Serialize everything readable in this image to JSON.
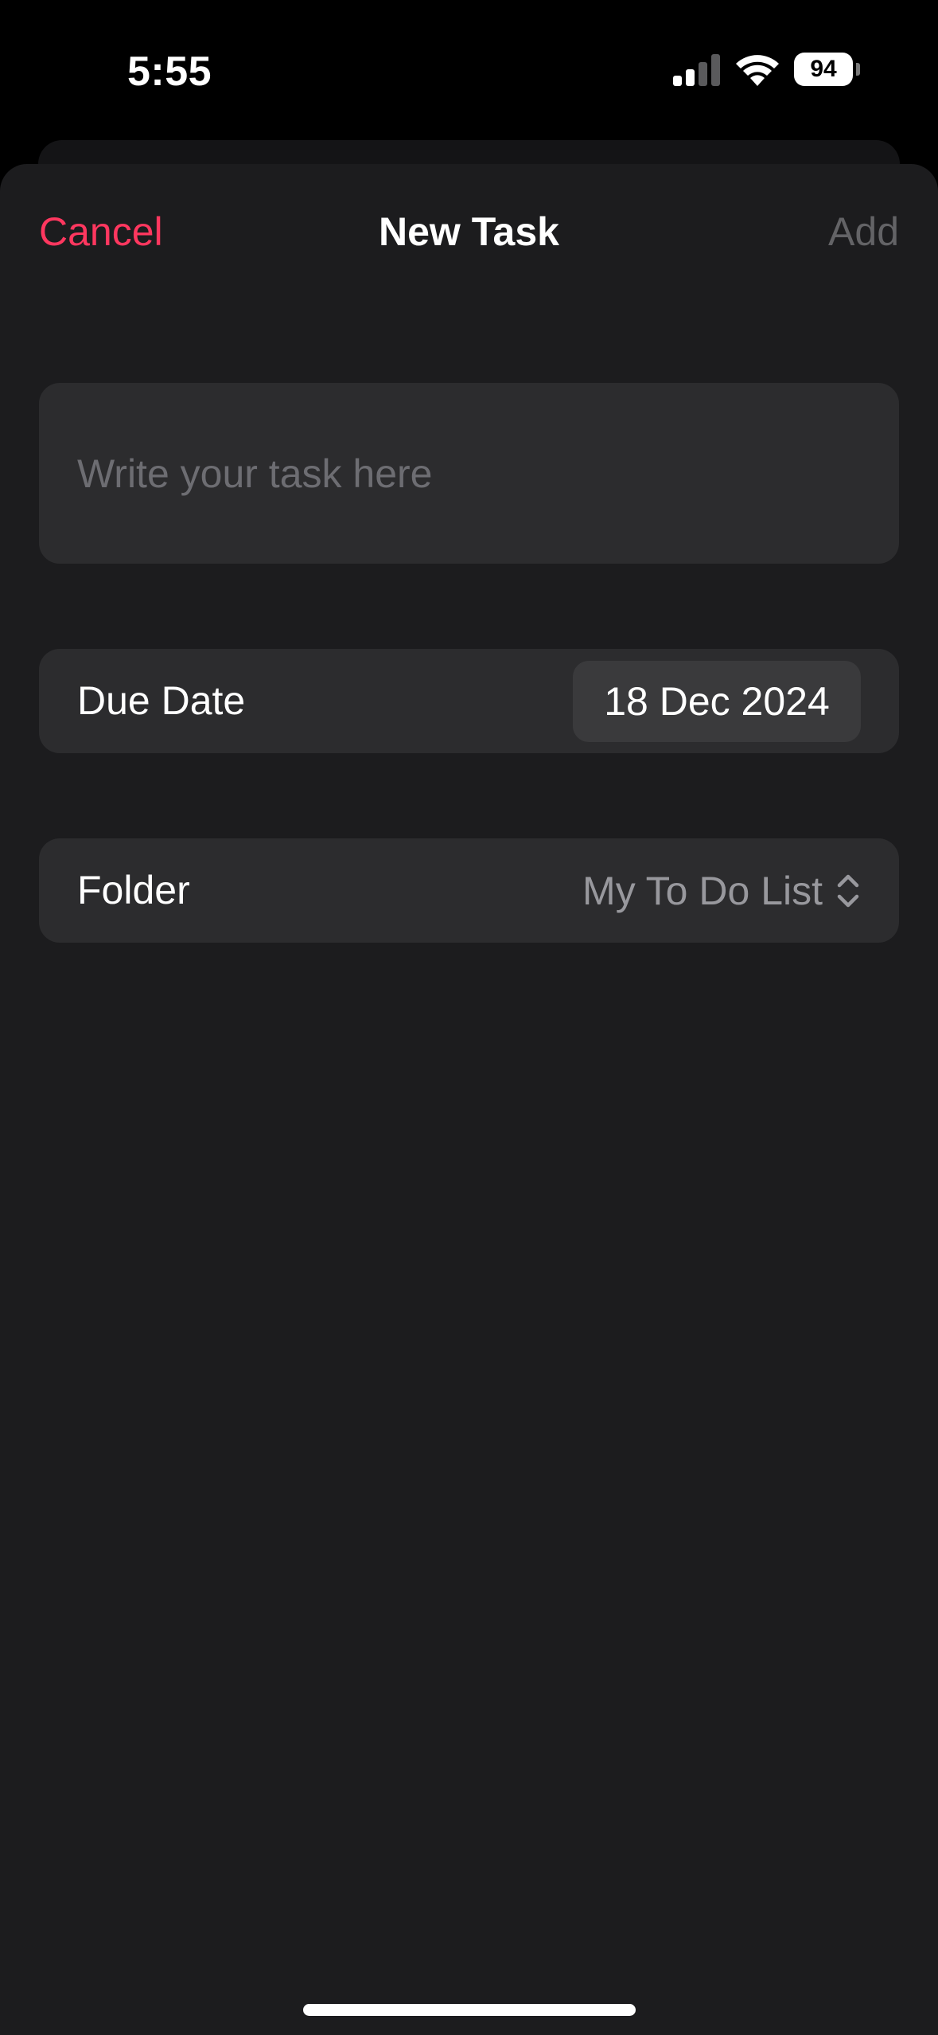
{
  "status_bar": {
    "time": "5:55",
    "battery_level": "94",
    "signal_icon": "cellular-signal-icon",
    "wifi_icon": "wifi-icon"
  },
  "nav": {
    "cancel_label": "Cancel",
    "title": "New Task",
    "add_label": "Add"
  },
  "task_input": {
    "value": "",
    "placeholder": "Write your task here"
  },
  "due_date": {
    "label": "Due Date",
    "value": "18 Dec 2024"
  },
  "folder": {
    "label": "Folder",
    "value": "My To Do List",
    "icon": "chevron-up-down-icon"
  },
  "colors": {
    "accent": "#ff375f",
    "sheet_bg": "#1c1c1e",
    "field_bg": "#2c2c2e"
  }
}
